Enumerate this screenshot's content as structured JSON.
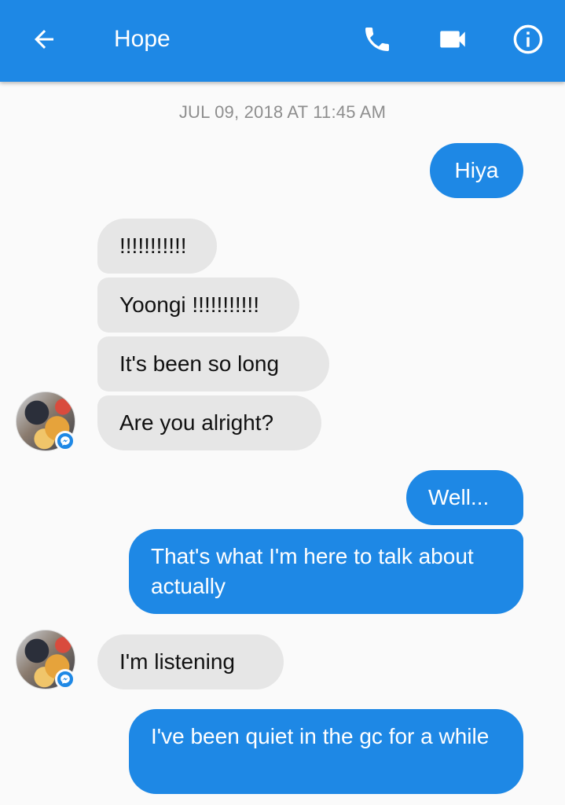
{
  "header": {
    "title": "Hope",
    "back_icon": "arrow-left-icon",
    "call_icon": "phone-icon",
    "video_icon": "video-camera-icon",
    "info_icon": "info-icon"
  },
  "conversation": {
    "timestamp": "JUL 09, 2018 AT 11:45 AM",
    "messages": [
      {
        "sender": "me",
        "text": "Hiya"
      },
      {
        "sender": "them",
        "text": "!!!!!!!!!!!"
      },
      {
        "sender": "them",
        "text": "Yoongi !!!!!!!!!!!"
      },
      {
        "sender": "them",
        "text": "It's been so long"
      },
      {
        "sender": "them",
        "text": "Are you alright?"
      },
      {
        "sender": "me",
        "text": "Well..."
      },
      {
        "sender": "me",
        "text": "That's what I'm here to talk about actually"
      },
      {
        "sender": "them",
        "text": "I'm listening"
      },
      {
        "sender": "me",
        "text": "I've been quiet in the gc for a while"
      }
    ]
  },
  "colors": {
    "accent": "#1e88e5",
    "incoming_bubble": "#e6e6e6",
    "background": "#fafafa",
    "timestamp": "#8e8e8e"
  }
}
